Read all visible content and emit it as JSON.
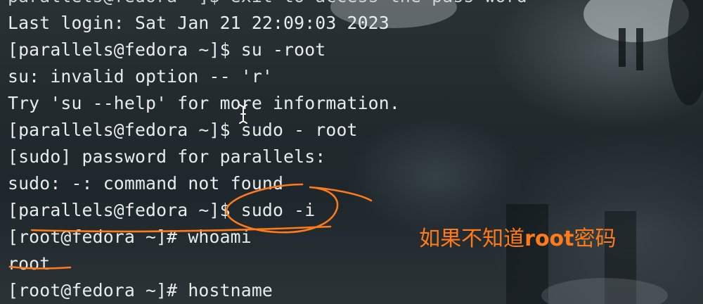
{
  "terminal": {
    "lines": [
      "parallels@fedora ~]$ exit to access the pass-word",
      "Last login: Sat Jan 21 22:09:03 2023",
      "[parallels@fedora ~]$ su -root",
      "su: invalid option -- 'r'",
      "Try 'su --help' for more information.",
      "[parallels@fedora ~]$ sudo - root",
      "[sudo] password for parallels:",
      "sudo: -: command not found",
      "[parallels@fedora ~]$ sudo -i",
      "[root@fedora ~]# whoami",
      "root",
      "[root@fedora ~]# hostname"
    ]
  },
  "annotation": {
    "text_before": "如果不知道",
    "text_bold": "root",
    "text_after": "密码",
    "color": "#ff7a1a"
  },
  "colors": {
    "terminal_text": "#e8ecec",
    "background": "#222a2e"
  },
  "icons": {
    "cursor": "ibeam-cursor-icon"
  }
}
